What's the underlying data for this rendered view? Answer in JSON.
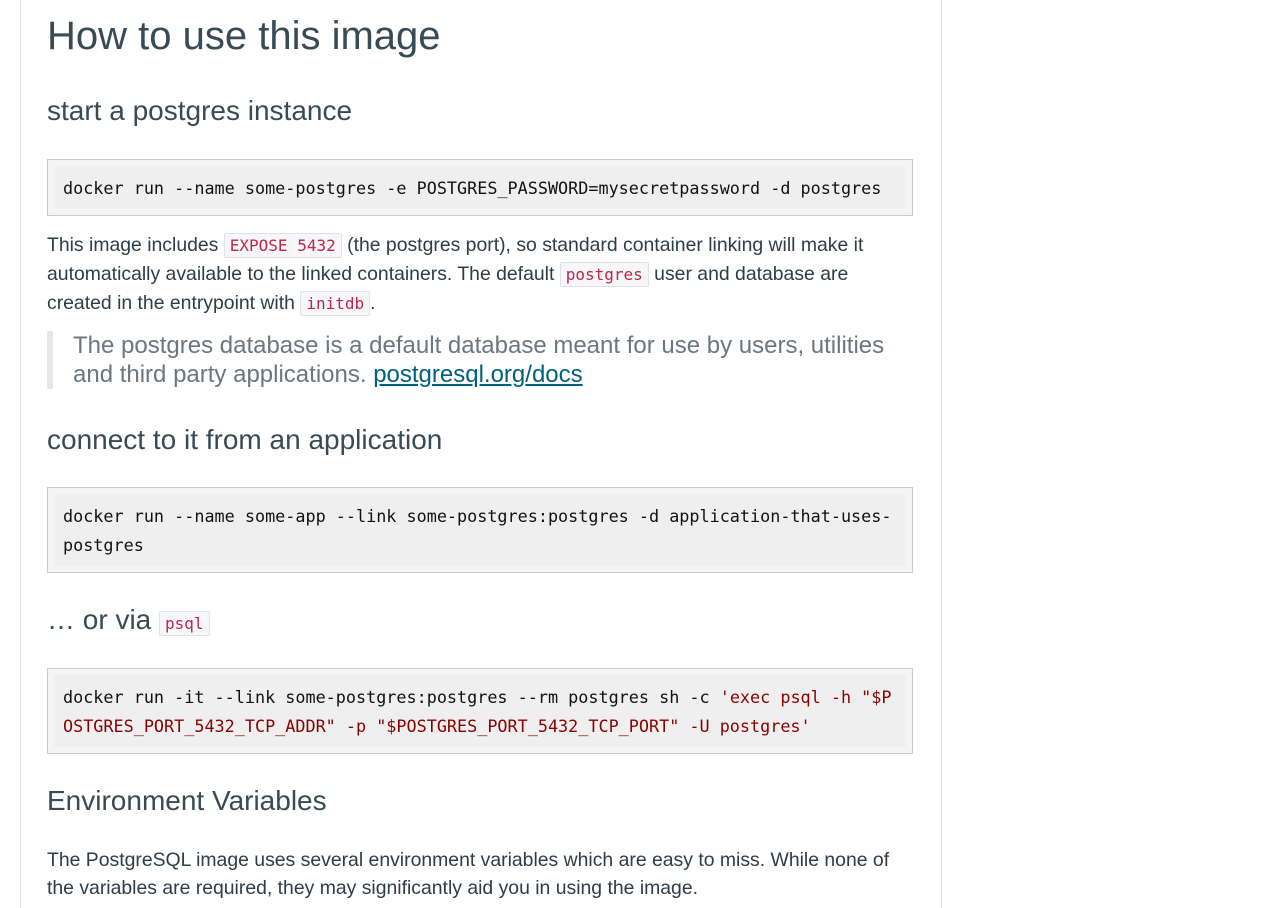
{
  "page": {
    "title": "How to use this image",
    "sections": {
      "start": {
        "heading": "start a postgres instance",
        "code": "docker run --name some-postgres -e POSTGRES_PASSWORD=mysecretpassword -d postgres"
      },
      "intro": {
        "text1": "This image includes ",
        "code1": "EXPOSE 5432",
        "text2": " (the postgres port), so standard container linking will make it automatically available to the linked containers. The default ",
        "code2": "postgres",
        "text3": " user and database are created in the entrypoint with ",
        "code3": "initdb",
        "text4": "."
      },
      "quote": {
        "text": "The postgres database is a default database meant for use by users, utilities and third party applications. ",
        "link": "postgresql.org/docs"
      },
      "connect": {
        "heading": "connect to it from an application",
        "code": "docker run --name some-app --link some-postgres:postgres -d application-that-uses-postgres"
      },
      "psql": {
        "heading_prefix": "… or via ",
        "heading_code": "psql",
        "code_plain": "docker run -it --link some-postgres:postgres --rm postgres sh -c ",
        "code_string": "'exec psql -h \"$POSTGRES_PORT_5432_TCP_ADDR\" -p \"$POSTGRES_PORT_5432_TCP_PORT\" -U postgres'"
      },
      "env": {
        "heading": "Environment Variables",
        "text": "The PostgreSQL image uses several environment variables which are easy to miss. While none of the variables are required, they may significantly aid you in using the image."
      }
    }
  }
}
